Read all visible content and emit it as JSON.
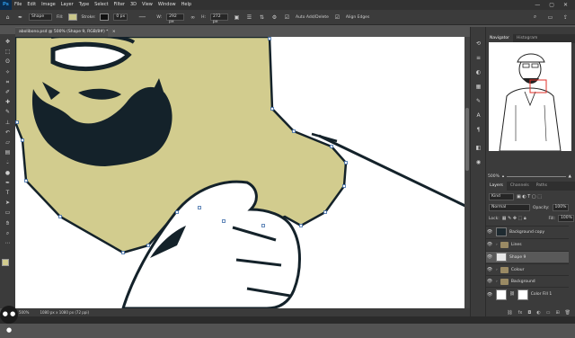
{
  "app": {
    "logo": "Ps"
  },
  "menu": [
    "File",
    "Edit",
    "Image",
    "Layer",
    "Type",
    "Select",
    "Filter",
    "3D",
    "View",
    "Window",
    "Help"
  ],
  "window_controls": {
    "minimize": "—",
    "maximize": "▢",
    "close": "✕"
  },
  "options": {
    "mode": "Shape",
    "fill_label": "Fill:",
    "stroke_label": "Stroke:",
    "stroke_width": "0 px",
    "w_label": "W:",
    "w_value": "292 px",
    "h_label": "H:",
    "h_value": "272 px",
    "auto_add_delete": "Auto Add/Delete",
    "align_edges": "Align Edges",
    "fill_color": "#c9c68a",
    "stroke_color": "#111111"
  },
  "document": {
    "tab_title": "abolibono.psd @ 500% (Shape 9, RGB/8#) *",
    "close": "×"
  },
  "status": {
    "zoom": "500%",
    "dims": "1080 px x 1080 px (72 ppi)"
  },
  "navigator": {
    "tab_active": "Navigator",
    "tab_other": "Histogram",
    "zoom": "500%"
  },
  "layers_panel": {
    "tabs": [
      "Layers",
      "Channels",
      "Paths"
    ],
    "kind": "Kind",
    "blend": "Normal",
    "opacity_label": "Opacity:",
    "opacity": "100%",
    "lock_label": "Lock:",
    "fill_label": "Fill:",
    "fill": "100%",
    "layers": [
      {
        "name": "Background copy"
      },
      {
        "name": "Lines"
      },
      {
        "name": "Shape 9"
      },
      {
        "name": "Colour"
      },
      {
        "name": "Background"
      },
      {
        "name": "Color Fill 1"
      }
    ]
  },
  "colors": {
    "skin": "#d2cc8e",
    "ink": "#14222a",
    "canvas": "#ffffff",
    "path": "#3c6ba8"
  },
  "bubble": "● ● ●"
}
